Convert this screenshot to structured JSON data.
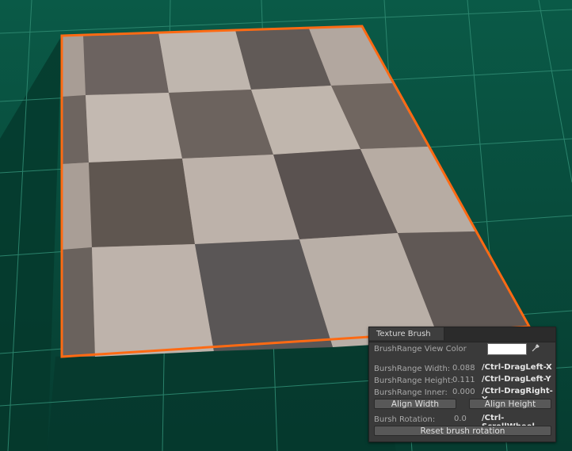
{
  "panel": {
    "title": "Texture Brush",
    "view_color_label": "BrushRange View Color",
    "view_color": "#ffffff",
    "width_label": "BurshRange Width:",
    "width_value": "0.088",
    "width_shortcut": "/Ctrl-DragLeft-X",
    "height_label": "BurshRange Height:",
    "height_value": "0.111",
    "height_shortcut": "/Ctrl-DragLeft-Y",
    "inner_label": "BurshRange Inner:",
    "inner_value": "0.000",
    "inner_shortcut": "/Ctrl-DragRight-X",
    "align_width_label": "Align Width",
    "align_height_label": "Align Height",
    "rotation_label": "Bursh Rotation:",
    "rotation_value": "0.0",
    "rotation_shortcut": "/Ctrl-ScrollWheel",
    "reset_label": "Reset brush rotation"
  },
  "icons": {
    "color_picker": "eyedropper-icon"
  },
  "colors": {
    "background": "#0b4a3a",
    "selection_outline": "#ff6a13",
    "panel_bg": "#3a3a3a"
  }
}
